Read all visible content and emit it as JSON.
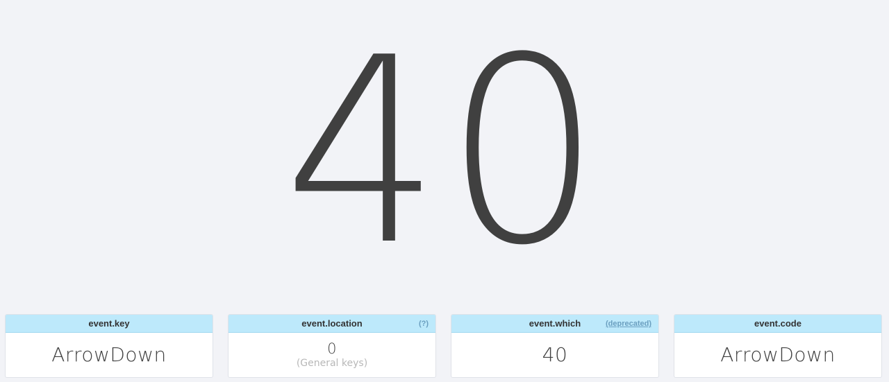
{
  "main": {
    "key_code": "40"
  },
  "cards": [
    {
      "title": "event.key",
      "value": "ArrowDown"
    },
    {
      "title": "event.location",
      "extra": "(?)",
      "value": "0",
      "sub": "(General keys)"
    },
    {
      "title": "event.which",
      "extra": "(deprecated)",
      "value": "40"
    },
    {
      "title": "event.code",
      "value": "ArrowDown"
    }
  ],
  "colors": {
    "background": "#f2f3f7",
    "card_header": "#bde9fb",
    "text": "#404040",
    "link": "#6a9fc0"
  }
}
